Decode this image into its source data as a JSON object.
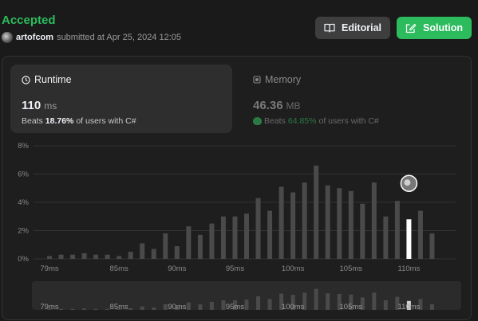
{
  "submission": {
    "status": "Accepted",
    "username": "artofcom",
    "submitted_text": "submitted at Apr 25, 2024 12:05"
  },
  "buttons": {
    "editorial": "Editorial",
    "solution": "Solution"
  },
  "runtime": {
    "title": "Runtime",
    "value": "110",
    "unit": "ms",
    "beats_prefix": "Beats",
    "beats_pct": "18.76%",
    "beats_suffix": "of users with C#"
  },
  "memory": {
    "title": "Memory",
    "value": "46.36",
    "unit": "MB",
    "beats_prefix": "Beats",
    "beats_pct": "64.85%",
    "beats_suffix": "of users with C#"
  },
  "colors": {
    "accent": "#2cbb5d",
    "bar": "#4a4a4a",
    "bar_highlight": "#ffffff"
  },
  "chart_data": {
    "type": "bar",
    "x_unit": "ms",
    "y_ticks": [
      "8%",
      "6%",
      "4%",
      "2%",
      "0%"
    ],
    "ylim": [
      0,
      8
    ],
    "x_ticks": [
      "79ms",
      "85ms",
      "90ms",
      "95ms",
      "100ms",
      "105ms",
      "110ms"
    ],
    "x_tick_values": [
      79,
      85,
      90,
      95,
      100,
      105,
      110
    ],
    "x": [
      79,
      80,
      81,
      82,
      83,
      84,
      85,
      86,
      87,
      88,
      89,
      90,
      91,
      92,
      93,
      94,
      95,
      96,
      97,
      98,
      99,
      100,
      101,
      102,
      103,
      104,
      105,
      106,
      107,
      108,
      109,
      110,
      111,
      112,
      113
    ],
    "values": [
      0.2,
      0.3,
      0.3,
      0.4,
      0.3,
      0.3,
      0.2,
      0.5,
      1.1,
      0.7,
      1.8,
      0.9,
      2.3,
      1.7,
      2.5,
      3.0,
      3.0,
      3.2,
      4.3,
      3.4,
      5.1,
      4.7,
      5.4,
      6.6,
      5.2,
      5.0,
      4.8,
      3.9,
      5.4,
      3.0,
      4.1,
      2.8,
      3.4,
      1.8
    ],
    "highlight_x": 110,
    "highlight_value": 4.1,
    "grid": true
  }
}
